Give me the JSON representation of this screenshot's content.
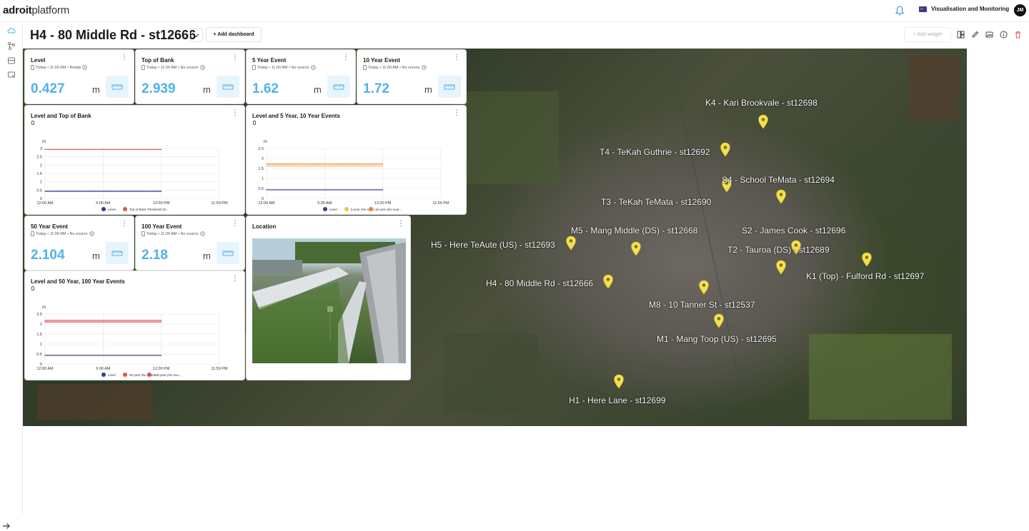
{
  "app": {
    "logo_bold": "adroit",
    "logo_light": "platform",
    "workspace": "Visualisation and Monitoring",
    "avatar_initials": "JM"
  },
  "dashboard": {
    "title": "H4 - 80 Middle Rd - st12666",
    "add_dashboard_label": "+ Add dashboard",
    "add_widget_label": "+ Add widget"
  },
  "metrics": [
    {
      "title": "Level",
      "subtitle": "Today • 11:00 AM • Ready",
      "value": "0.427",
      "unit": "m"
    },
    {
      "title": "Top of Bank",
      "subtitle": "Today • 11:00 AM • No source",
      "value": "2.939",
      "unit": "m"
    },
    {
      "title": "5 Year Event",
      "subtitle": "Today • 11:00 AM • No source",
      "value": "1.62",
      "unit": "m"
    },
    {
      "title": "10 Year Event",
      "subtitle": "Today • 11:00 AM • No source",
      "value": "1.72",
      "unit": "m"
    },
    {
      "title": "50 Year Event",
      "subtitle": "Today • 11:00 AM • No source",
      "value": "2.104",
      "unit": "m"
    },
    {
      "title": "100 Year Event",
      "subtitle": "Today • 11:00 AM • No source",
      "value": "2.18",
      "unit": "m"
    }
  ],
  "location": {
    "title": "Location"
  },
  "chart_data": [
    {
      "type": "line",
      "title": "Level and Top of Bank",
      "ylabel": "m",
      "x_ticks": [
        "12:00 AM",
        "6:00 AM",
        "12:00 PM",
        "11:59 PM"
      ],
      "y_ticks": [
        "0",
        "0.5",
        "1",
        "1.5",
        "2",
        "2.5",
        "3"
      ],
      "ylim": [
        0,
        3
      ],
      "x": [
        "12:00 AM",
        "12:00 PM"
      ],
      "series": [
        {
          "name": "Level",
          "values": [
            0.43,
            0.43
          ],
          "color": "#2d3f8f"
        },
        {
          "name": "Top of Bank Threshold (N...",
          "values": [
            2.939,
            2.939
          ],
          "color": "#e0564f"
        }
      ]
    },
    {
      "type": "line",
      "title": "Level and 5 Year, 10 Year Events",
      "ylabel": "m",
      "x_ticks": [
        "12:00 AM",
        "6:00 AM",
        "12:00 PM",
        "11:59 PM"
      ],
      "y_ticks": [
        "0",
        "0.5",
        "1",
        "1.5",
        "2",
        "2.5"
      ],
      "ylim": [
        0,
        2.5
      ],
      "x": [
        "12:00 AM",
        "12:00 PM"
      ],
      "series": [
        {
          "name": "Level",
          "values": [
            0.43,
            0.43
          ],
          "color": "#2d3f8f"
        },
        {
          "name": "5-year (No sourc...",
          "values": [
            1.62,
            1.62
          ],
          "color": "#f2c14e"
        },
        {
          "name": "10-year (No sour...",
          "values": [
            1.72,
            1.72
          ],
          "color": "#e9823a"
        }
      ]
    },
    {
      "type": "line",
      "title": "Level and 50 Year, 100 Year Events",
      "ylabel": "m",
      "x_ticks": [
        "12:00 AM",
        "6:00 AM",
        "12:00 PM",
        "11:59 PM"
      ],
      "y_ticks": [
        "0",
        "0.5",
        "1",
        "1.5",
        "2",
        "2.5"
      ],
      "ylim": [
        0,
        2.5
      ],
      "x": [
        "12:00 AM",
        "12:00 PM"
      ],
      "series": [
        {
          "name": "Level",
          "values": [
            0.43,
            0.43
          ],
          "color": "#2d3f8f"
        },
        {
          "name": "50-year (No sourc...",
          "values": [
            2.104,
            2.104
          ],
          "color": "#e0564f"
        },
        {
          "name": "100-year (No sou...",
          "values": [
            2.18,
            2.18
          ],
          "color": "#d9486b"
        }
      ]
    }
  ],
  "map_markers": [
    {
      "label": "K4 - Kari Brookvale - st12698"
    },
    {
      "label": "T4 - TeKah Guthrie - st12692"
    },
    {
      "label": "S4 - School TeMata - st12694"
    },
    {
      "label": "T3 - TeKah TeMata - st12690"
    },
    {
      "label": "M5 - Mang Middle (DS) - st12668"
    },
    {
      "label": "S2 - James Cook - st12696"
    },
    {
      "label": "H5 - Here TeAute (US) - st12693"
    },
    {
      "label": "T2 - Tauroa (DS) - st12689"
    },
    {
      "label": "K1 (Top) - Fulford Rd - st12697"
    },
    {
      "label": "H4 - 80 Middle Rd - st12666"
    },
    {
      "label": "M8 - 10 Tanner St - st12537"
    },
    {
      "label": "M1 - Mang Toop (US) - st12695"
    },
    {
      "label": "H1 - Here Lane - st12699"
    }
  ],
  "colors": {
    "accent": "#4fb3e8",
    "marker": "#f4e04d"
  }
}
